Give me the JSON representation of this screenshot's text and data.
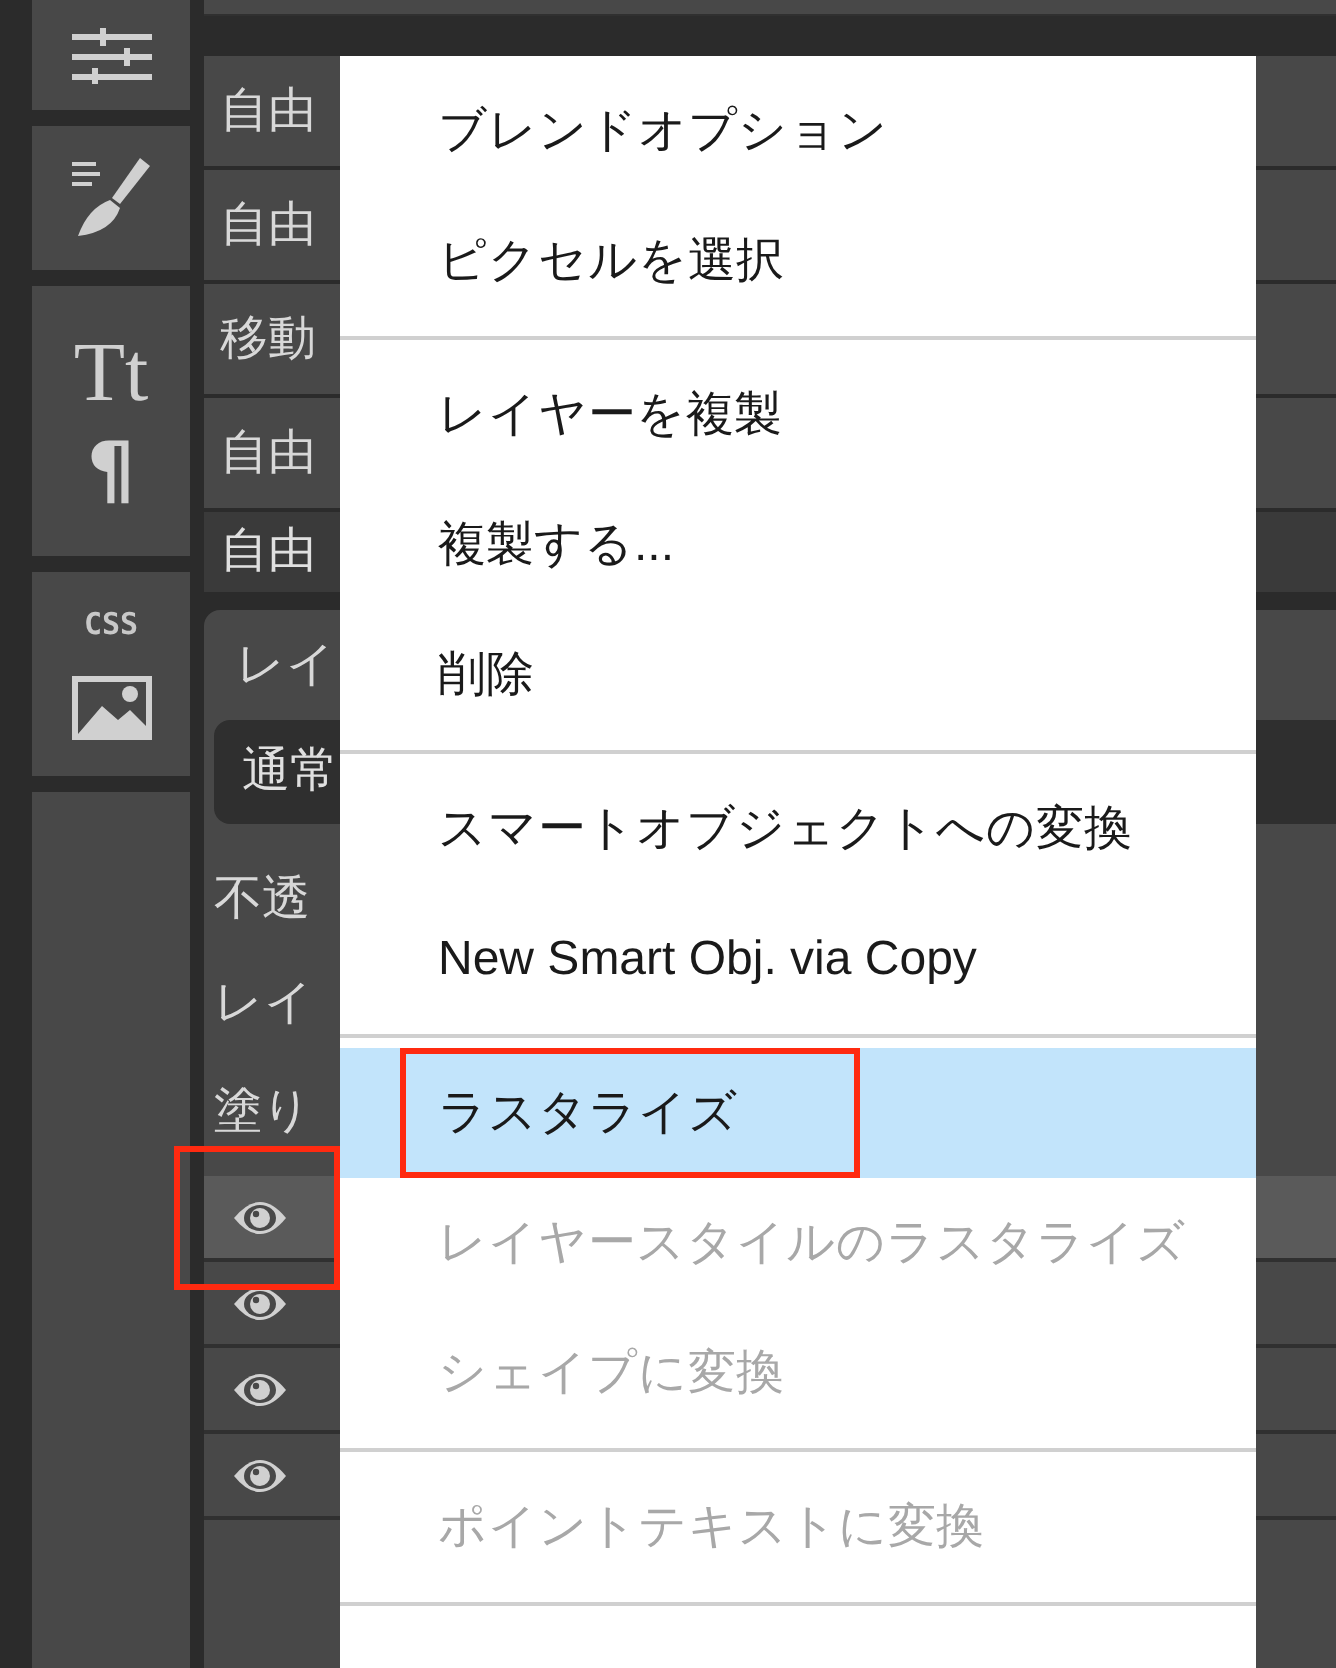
{
  "toolbar": {
    "type_label": "Tt",
    "paragraph_label": "¶",
    "css_label": "CSS"
  },
  "history": [
    {
      "label": "自由",
      "selected": false
    },
    {
      "label": "自由",
      "selected": false
    },
    {
      "label": "移動",
      "selected": false
    },
    {
      "label": "自由",
      "selected": false
    },
    {
      "label": "自由",
      "selected": true
    }
  ],
  "layers_panel": {
    "title": "レイ",
    "blend_mode": "通常",
    "opacity_label": "不透",
    "lock_label": "レイ",
    "fill_label": "塗り",
    "layers": [
      {
        "visible": true,
        "selected": true,
        "highlighted": true
      },
      {
        "visible": true,
        "selected": false,
        "highlighted": false
      },
      {
        "visible": true,
        "selected": false,
        "highlighted": false
      },
      {
        "visible": true,
        "selected": false,
        "highlighted": false
      }
    ]
  },
  "context_menu": {
    "sections": [
      [
        {
          "label": "ブレンドオプション",
          "selected": false,
          "disabled": false,
          "highlighted": false
        },
        {
          "label": "ピクセルを選択",
          "selected": false,
          "disabled": false,
          "highlighted": false
        }
      ],
      [
        {
          "label": "レイヤーを複製",
          "selected": false,
          "disabled": false,
          "highlighted": false
        },
        {
          "label": "複製する...",
          "selected": false,
          "disabled": false,
          "highlighted": false
        },
        {
          "label": "削除",
          "selected": false,
          "disabled": false,
          "highlighted": false
        }
      ],
      [
        {
          "label": "スマートオブジェクトへの変換",
          "selected": false,
          "disabled": false,
          "highlighted": false
        },
        {
          "label": "New Smart Obj. via Copy",
          "selected": false,
          "disabled": false,
          "highlighted": false
        }
      ],
      [
        {
          "label": "ラスタライズ",
          "selected": true,
          "disabled": false,
          "highlighted": true
        },
        {
          "label": "レイヤースタイルのラスタライズ",
          "selected": false,
          "disabled": true,
          "highlighted": false
        },
        {
          "label": "シェイプに変換",
          "selected": false,
          "disabled": true,
          "highlighted": false
        }
      ],
      [
        {
          "label": "ポイントテキストに変換",
          "selected": false,
          "disabled": true,
          "highlighted": false
        }
      ]
    ]
  }
}
